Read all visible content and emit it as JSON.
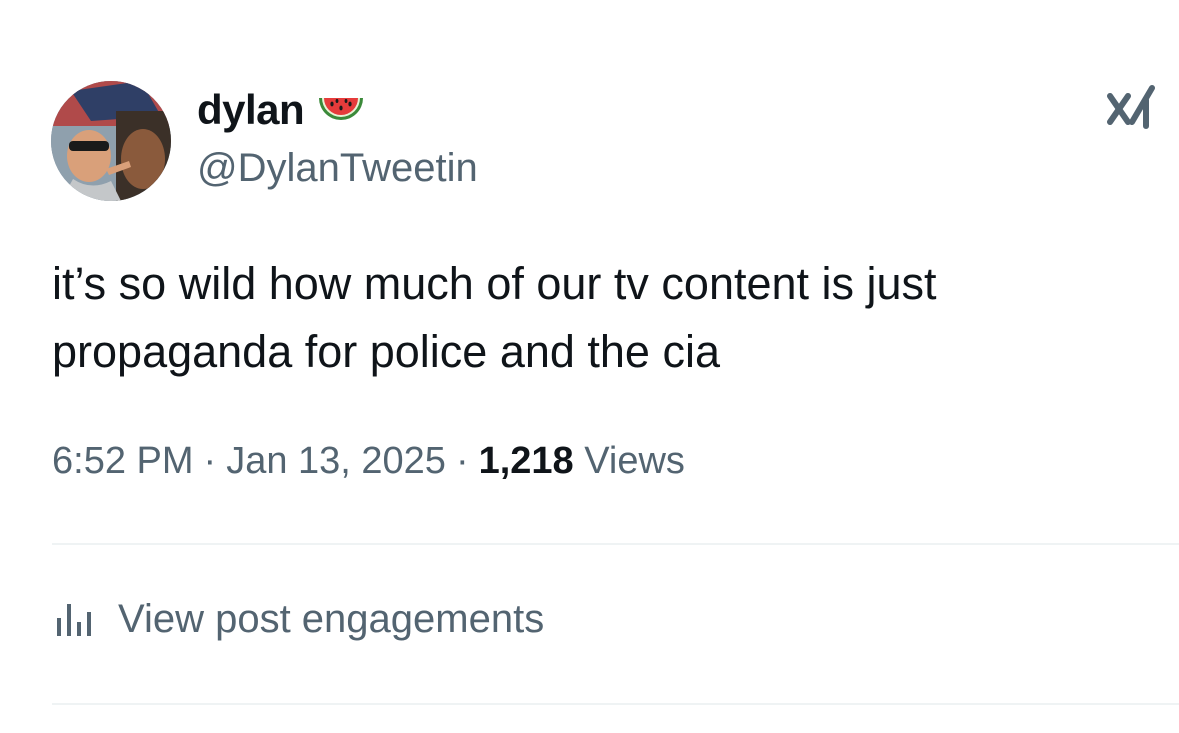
{
  "author": {
    "display_name": "dylan",
    "handle": "@DylanTweetin",
    "name_emoji": "watermelon-emoji"
  },
  "post": {
    "text": "it’s so wild how much of our tv content is just propaganda for police and the cia"
  },
  "meta": {
    "time": "6:52 PM",
    "separator": "·",
    "date": "Jan 13, 2025",
    "views_count": "1,218",
    "views_label": "Views"
  },
  "actions": {
    "engagements_label": "View post engagements",
    "engagements_icon": "analytics-bar-icon",
    "corner_icon": "grok-icon"
  },
  "colors": {
    "primary_text": "#0f1419",
    "secondary_text": "#536471",
    "divider": "#eff3f4"
  }
}
